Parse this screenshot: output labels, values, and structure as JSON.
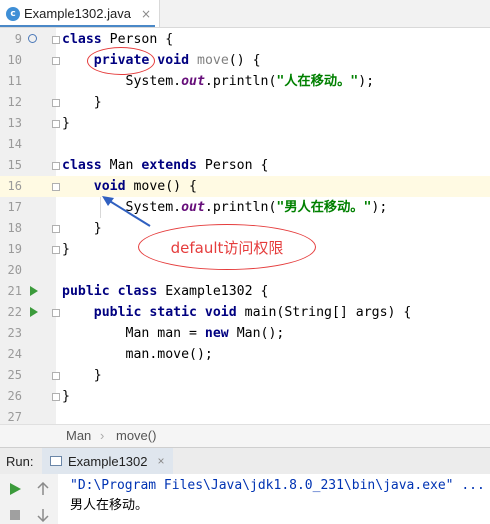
{
  "tab": {
    "icon": "c",
    "filename": "Example1302.java",
    "close": "×"
  },
  "code_lines": [
    {
      "num": "9",
      "text": [
        [
          "kw",
          "class"
        ],
        [
          "n",
          " Person {"
        ]
      ]
    },
    {
      "num": "10",
      "text": [
        [
          "n",
          "    "
        ],
        [
          "kw",
          "private"
        ],
        [
          "n",
          " "
        ],
        [
          "kw",
          "void"
        ],
        [
          "n",
          " "
        ],
        [
          "gray",
          "move"
        ],
        [
          "n",
          "() {"
        ]
      ]
    },
    {
      "num": "11",
      "text": [
        [
          "n",
          "        System."
        ],
        [
          "fld",
          "out"
        ],
        [
          "n",
          ".println("
        ],
        [
          "str",
          "\"人在移动。\""
        ],
        [
          "n",
          ");"
        ]
      ]
    },
    {
      "num": "12",
      "text": [
        [
          "n",
          "    }"
        ]
      ]
    },
    {
      "num": "13",
      "text": [
        [
          "n",
          "}"
        ]
      ]
    },
    {
      "num": "14",
      "text": [
        [
          "n",
          ""
        ]
      ]
    },
    {
      "num": "15",
      "text": [
        [
          "kw",
          "class"
        ],
        [
          "n",
          " Man "
        ],
        [
          "kw",
          "extends"
        ],
        [
          "n",
          " Person {"
        ]
      ]
    },
    {
      "num": "16",
      "text": [
        [
          "n",
          "    "
        ],
        [
          "kw",
          "void"
        ],
        [
          "n",
          " move() {"
        ]
      ]
    },
    {
      "num": "17",
      "text": [
        [
          "n",
          "        System."
        ],
        [
          "fld",
          "out"
        ],
        [
          "n",
          ".println("
        ],
        [
          "str",
          "\"男人在移动。\""
        ],
        [
          "n",
          ");"
        ]
      ]
    },
    {
      "num": "18",
      "text": [
        [
          "n",
          "    }"
        ]
      ]
    },
    {
      "num": "19",
      "text": [
        [
          "n",
          "}"
        ]
      ]
    },
    {
      "num": "20",
      "text": [
        [
          "n",
          ""
        ]
      ]
    },
    {
      "num": "21",
      "text": [
        [
          "kw",
          "public class"
        ],
        [
          "n",
          " Example1302 {"
        ]
      ]
    },
    {
      "num": "22",
      "text": [
        [
          "n",
          "    "
        ],
        [
          "kw",
          "public static void"
        ],
        [
          "n",
          " main(String[] args) {"
        ]
      ]
    },
    {
      "num": "23",
      "text": [
        [
          "n",
          "        Man man = "
        ],
        [
          "kw",
          "new"
        ],
        [
          "n",
          " Man();"
        ]
      ]
    },
    {
      "num": "24",
      "text": [
        [
          "n",
          "        man.move();"
        ]
      ]
    },
    {
      "num": "25",
      "text": [
        [
          "n",
          "    }"
        ]
      ]
    },
    {
      "num": "26",
      "text": [
        [
          "n",
          "}"
        ]
      ]
    },
    {
      "num": "27",
      "text": [
        [
          "n",
          ""
        ]
      ]
    }
  ],
  "annotation": {
    "label": "default访问权限"
  },
  "breadcrumb": {
    "item1": "Man",
    "item2": "move()"
  },
  "run": {
    "label": "Run:",
    "tab": "Example1302",
    "close": "×"
  },
  "console": {
    "line1": "\"D:\\Program Files\\Java\\jdk1.8.0_231\\bin\\java.exe\" ...",
    "line2": "男人在移动。"
  }
}
